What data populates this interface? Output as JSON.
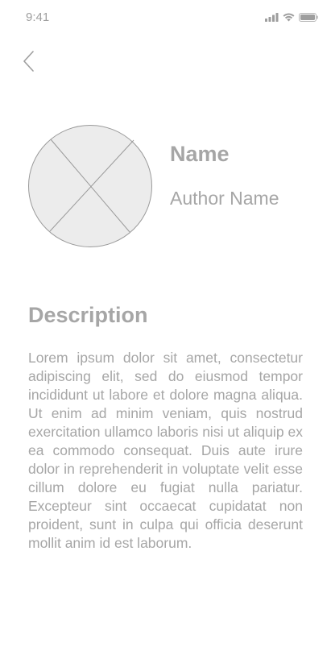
{
  "status_bar": {
    "time": "9:41",
    "icons": [
      "signal-icon",
      "wifi-icon",
      "battery-icon"
    ]
  },
  "nav": {
    "back_icon": "chevron-left-icon"
  },
  "profile": {
    "avatar_icon": "image-placeholder-icon",
    "name_heading": "Name",
    "author_name": "Author Name"
  },
  "description": {
    "heading": "Description",
    "body": "Lorem ipsum dolor sit amet, consectetur adipiscing elit, sed do eiusmod tempor incididunt ut labore et dolore magna aliqua. Ut enim ad minim veniam, quis nostrud exercitation ullamco laboris nisi ut aliquip ex ea commodo consequat. Duis aute irure dolor in reprehenderit in voluptate velit esse cillum dolore eu fugiat nulla pariatur. Excepteur sint occaecat cupidatat non proident, sunt in culpa qui officia deserunt mollit anim id est laborum."
  },
  "colors": {
    "text": "#a6a6a6",
    "placeholder_fill": "#ececec",
    "placeholder_stroke": "#9a9a9a",
    "background": "#ffffff"
  }
}
